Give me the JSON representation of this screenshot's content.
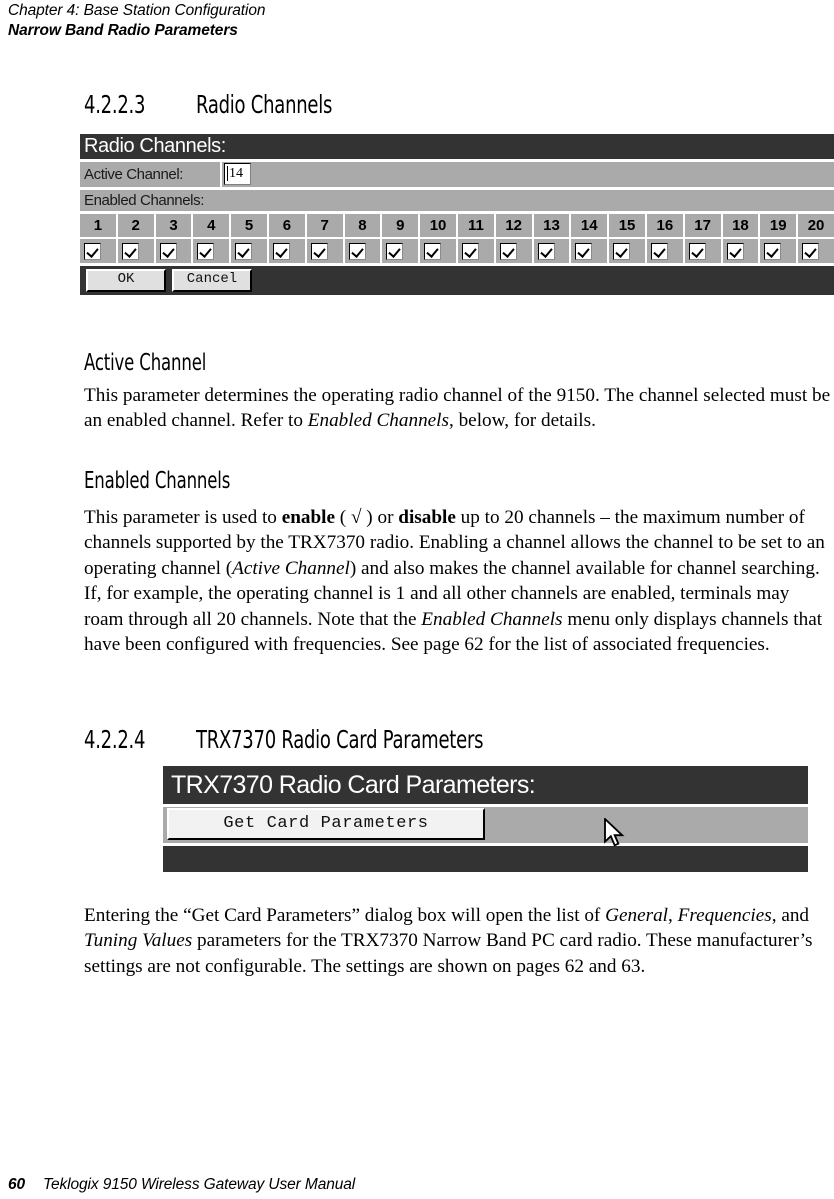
{
  "running_head": {
    "chapter": "Chapter 4:  Base Station Configuration",
    "section": "Narrow Band Radio Parameters"
  },
  "sections": {
    "s4223": {
      "number": "4.2.2.3",
      "title": "Radio  Channels"
    },
    "s4224": {
      "number": "4.2.2.4",
      "title": "TRX7370  Radio  Card  Parameters"
    }
  },
  "radio_channels_dialog": {
    "title": "Radio Channels:",
    "active_channel_label": "Active Channel:",
    "active_channel_value": "14",
    "enabled_channels_label": "Enabled Channels:",
    "channels": [
      {
        "number": "1",
        "enabled": true
      },
      {
        "number": "2",
        "enabled": true
      },
      {
        "number": "3",
        "enabled": true
      },
      {
        "number": "4",
        "enabled": true
      },
      {
        "number": "5",
        "enabled": true
      },
      {
        "number": "6",
        "enabled": true
      },
      {
        "number": "7",
        "enabled": true
      },
      {
        "number": "8",
        "enabled": true
      },
      {
        "number": "9",
        "enabled": true
      },
      {
        "number": "10",
        "enabled": true
      },
      {
        "number": "11",
        "enabled": true
      },
      {
        "number": "12",
        "enabled": true
      },
      {
        "number": "13",
        "enabled": true
      },
      {
        "number": "14",
        "enabled": true
      },
      {
        "number": "15",
        "enabled": true
      },
      {
        "number": "16",
        "enabled": true
      },
      {
        "number": "17",
        "enabled": true
      },
      {
        "number": "18",
        "enabled": true
      },
      {
        "number": "19",
        "enabled": true
      },
      {
        "number": "20",
        "enabled": true
      }
    ],
    "ok_label": "OK",
    "cancel_label": "Cancel"
  },
  "trx_dialog": {
    "title": "TRX7370 Radio Card Parameters:",
    "get_card_parameters_label": "Get Card Parameters"
  },
  "headings": {
    "active_channel": "Active  Channel",
    "enabled_channels": "Enabled  Channels"
  },
  "paragraphs": {
    "active_channel_p1_a": "This parameter determines the operating radio channel of the 9150. The channel selected must be an enabled channel. Refer to ",
    "active_channel_p1_em": "Enabled Channels",
    "active_channel_p1_b": ", below, for details.",
    "enabled_p_a": "This parameter is used to ",
    "enabled_p_b1": "enable",
    "enabled_p_b": " ( √ ) or ",
    "enabled_p_b2": "disable",
    "enabled_p_c": " up to 20 channels – the maximum number of channels supported by the TRX7370 radio. Enabling a channel allows the channel to be set to an operating channel (",
    "enabled_p_em1": "Active Channel",
    "enabled_p_d": ") and also makes the channel available for channel searching. If, for example, the operating channel is 1 and all other channels are enabled, terminals may roam through all 20 channels. Note that the ",
    "enabled_p_em2": "Enabled Channels",
    "enabled_p_e": " menu only displays channels that have been configured with frequencies. See page 62 for the list of associated frequencies.",
    "trx_p_a": "Entering the “Get Card Parameters” dialog box will open the list of ",
    "trx_p_em1": "General",
    "trx_p_b": ", ",
    "trx_p_em2": "Frequencies",
    "trx_p_c": ", and ",
    "trx_p_em3": "Tuning Values",
    "trx_p_d": " parameters for the TRX7370 Narrow Band PC card radio. These manufacturer’s settings are not configurable. The settings are shown on pages 62 and 63."
  },
  "page_footer": {
    "page_number": "60",
    "manual_title": "Teklogix 9150 Wireless Gateway User Manual"
  },
  "colors": {
    "titlebar": "#333333",
    "dialog_face": "#aaaaaa",
    "button_face": "#e0e0e0"
  }
}
